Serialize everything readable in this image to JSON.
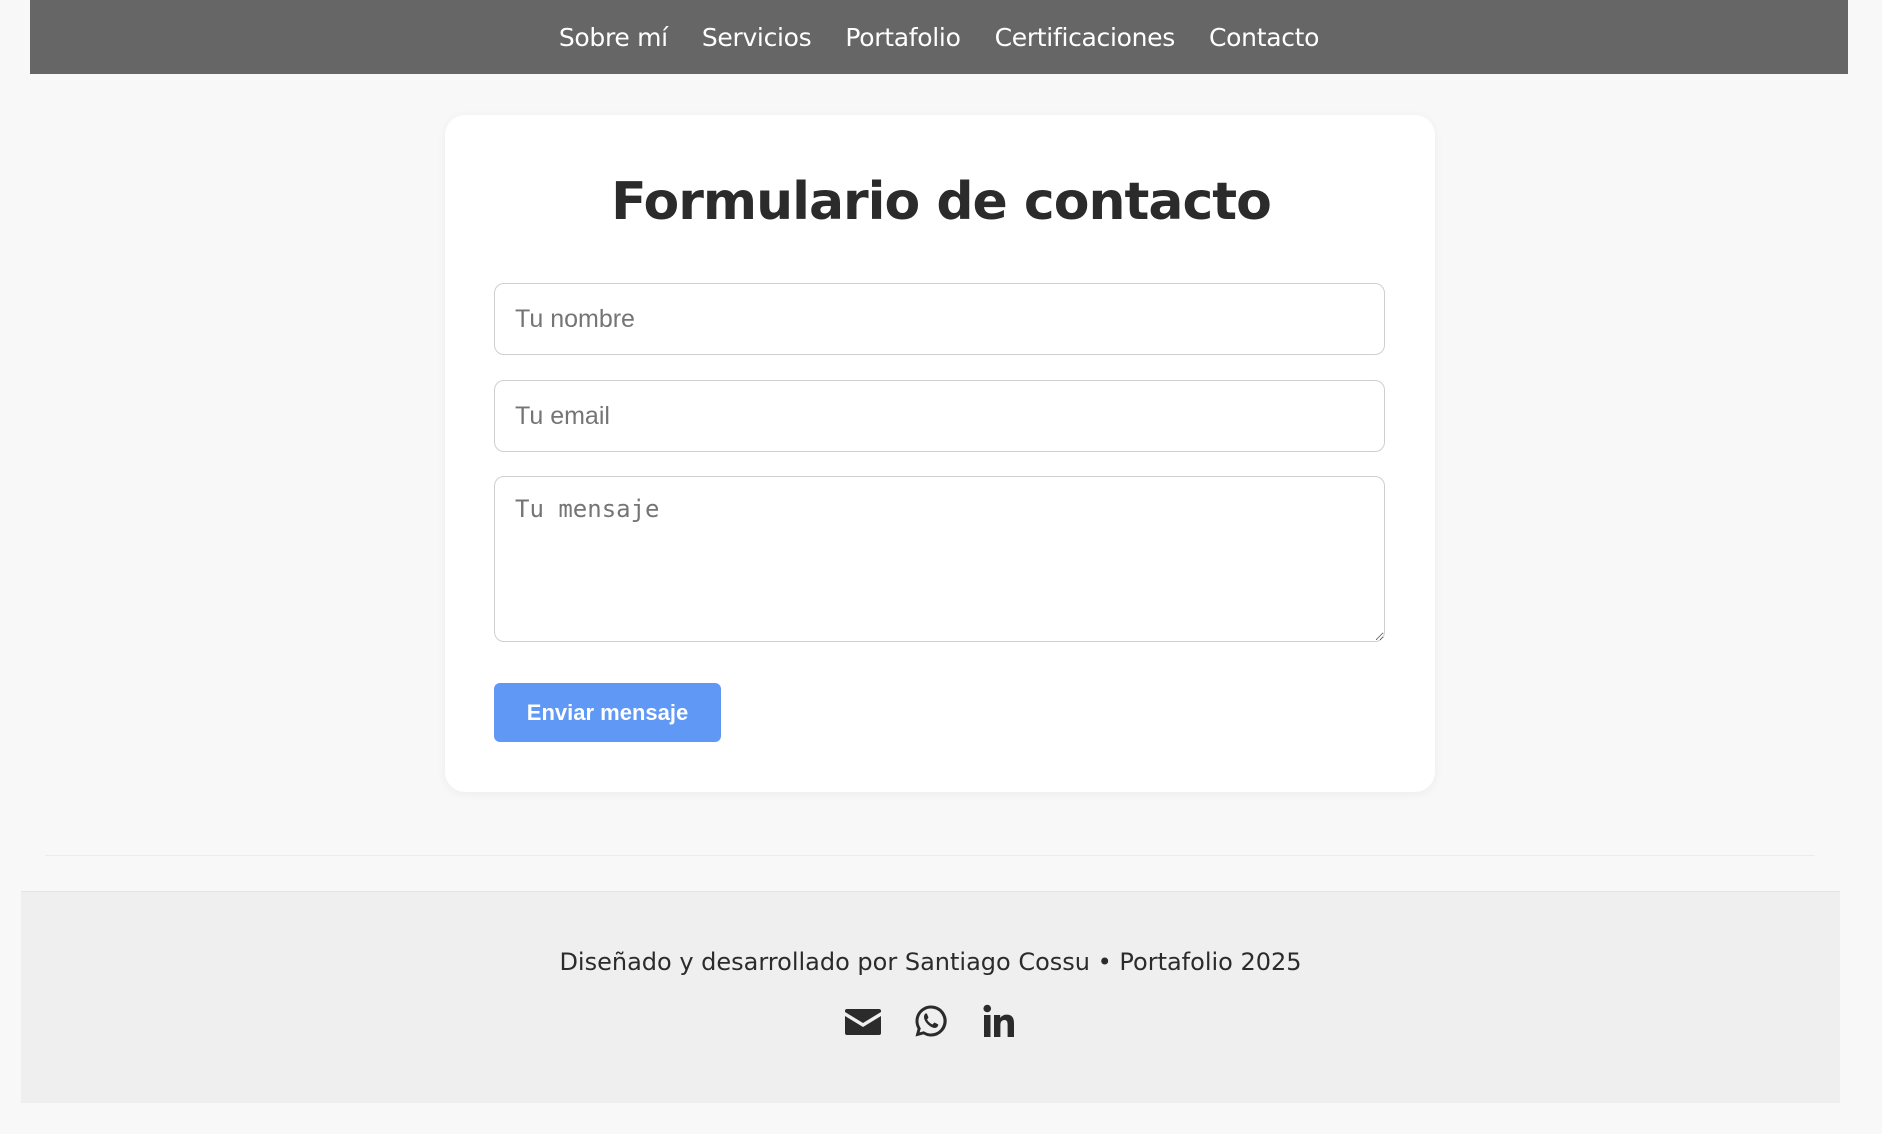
{
  "nav": {
    "items": [
      {
        "label": "Sobre mí"
      },
      {
        "label": "Servicios"
      },
      {
        "label": "Portafolio"
      },
      {
        "label": "Certificaciones"
      },
      {
        "label": "Contacto"
      }
    ]
  },
  "form": {
    "title": "Formulario de contacto",
    "name_placeholder": "Tu nombre",
    "email_placeholder": "Tu email",
    "message_placeholder": "Tu mensaje",
    "submit_label": "Enviar mensaje"
  },
  "footer": {
    "credit": "Diseñado y desarrollado por Santiago Cossu • Portafolio 2025",
    "social_icons": [
      "envelope-icon",
      "whatsapp-icon",
      "linkedin-icon"
    ]
  },
  "colors": {
    "nav_background": "#666666",
    "button": "#6098f5",
    "page_background": "#f8f8f8",
    "footer_background": "#efefef"
  }
}
